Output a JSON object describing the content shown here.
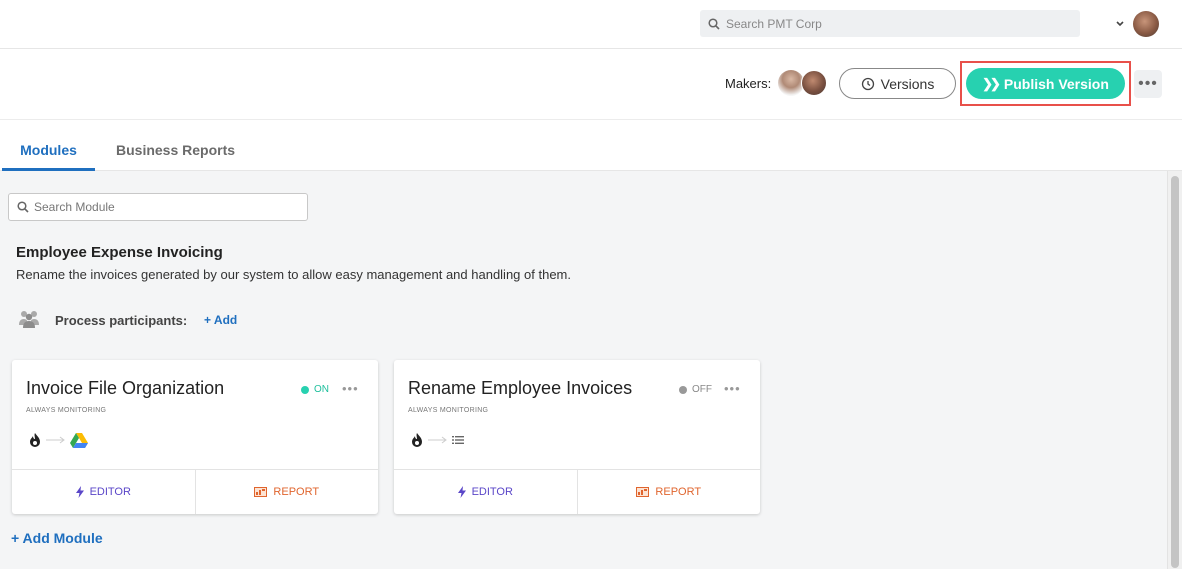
{
  "topbar": {
    "search_placeholder": "Search PMT Corp",
    "icons": [
      "search-icon",
      "chevron-down-icon",
      "avatar"
    ]
  },
  "header": {
    "makers_label": "Makers:",
    "versions_label": "Versions",
    "publish_label": "Publish Version",
    "more_label": "•••"
  },
  "tabs": [
    {
      "label": "Modules",
      "active": true
    },
    {
      "label": "Business Reports",
      "active": false
    }
  ],
  "main": {
    "search_placeholder": "Search Module",
    "process_title": "Employee Expense Invoicing",
    "process_description": "Rename the invoices generated by our system to allow easy management and handling of them.",
    "participants_label": "Process participants:",
    "participants_add": "+ Add",
    "add_module": "+ Add Module"
  },
  "modules": [
    {
      "title": "Invoice File Organization",
      "subtitle": "ALWAYS MONITORING",
      "status": "ON",
      "more": "•••",
      "flow": [
        "fire-icon",
        "google-drive-icon"
      ],
      "editor_label": "EDITOR",
      "report_label": "REPORT"
    },
    {
      "title": "Rename Employee Invoices",
      "subtitle": "ALWAYS MONITORING",
      "status": "OFF",
      "more": "•••",
      "flow": [
        "fire-icon",
        "list-icon"
      ],
      "editor_label": "EDITOR",
      "report_label": "REPORT"
    }
  ],
  "colors": {
    "accent": "#27d1b0",
    "link": "#1f6fbf",
    "highlight": "#e8504a",
    "editor": "#5a46c8",
    "report": "#e0652e"
  }
}
